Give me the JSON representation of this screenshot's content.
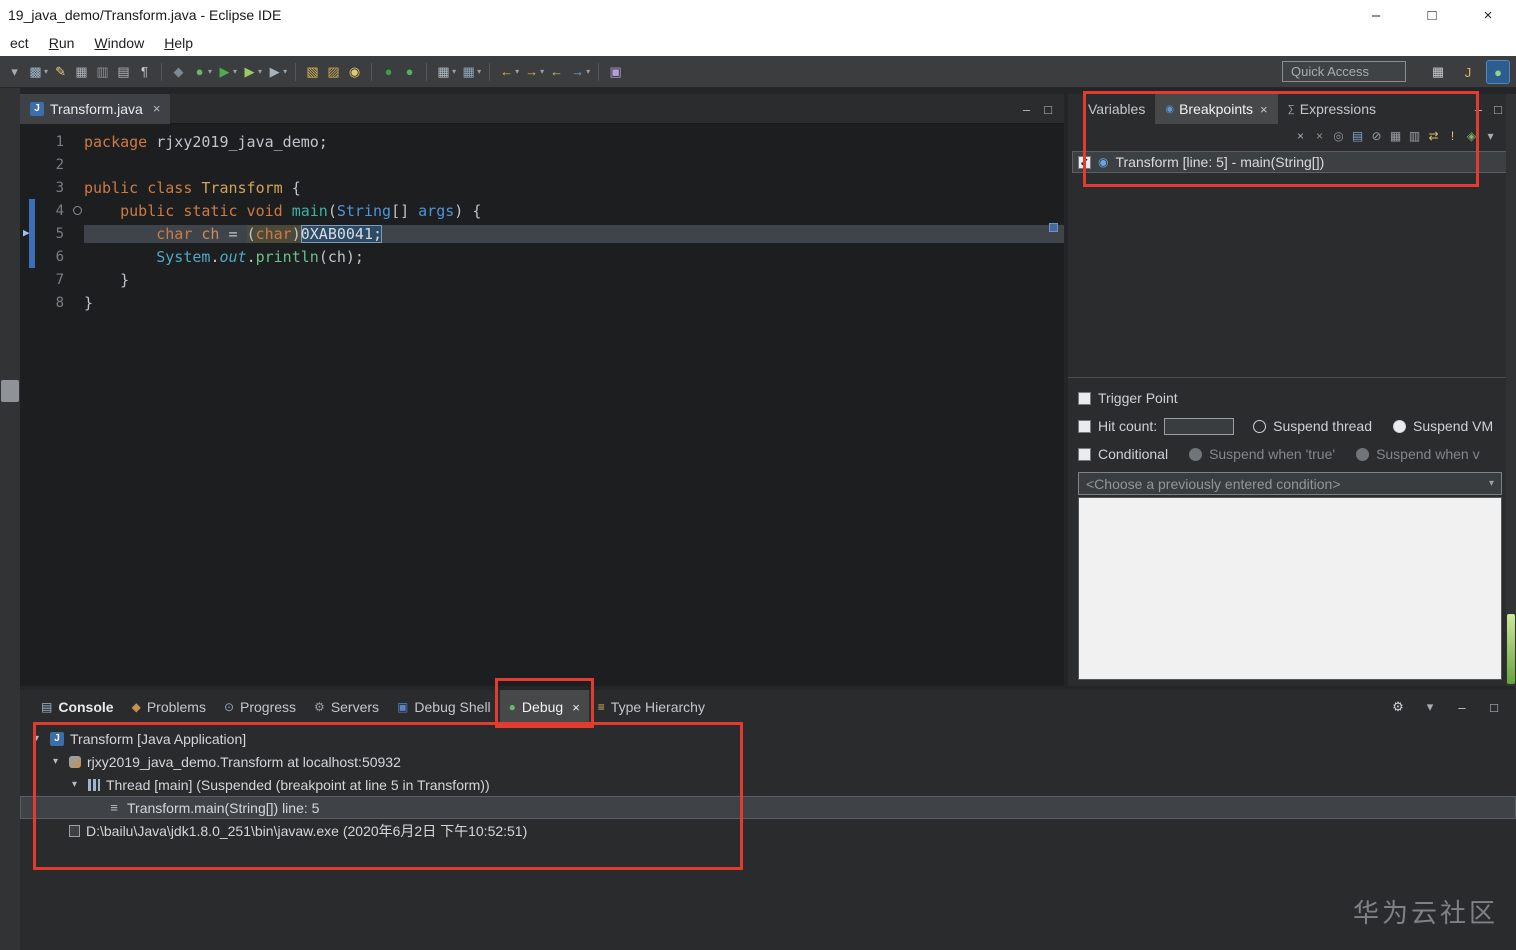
{
  "window": {
    "title": "19_java_demo/Transform.java - Eclipse IDE"
  },
  "icons": {
    "minimize": "–",
    "maximize": "□",
    "close": "×",
    "chevron_down": "▾"
  },
  "colors": {
    "annotation_red": "#e23c30",
    "breakpoint_blue": "#6aa7e0",
    "scroll_thumb_green": "#68a33e"
  },
  "menubar": {
    "items": [
      {
        "label": "ect",
        "accel": false
      },
      {
        "label": "Run",
        "accel": true
      },
      {
        "label": "Window",
        "accel": true
      },
      {
        "label": "Help",
        "accel": true
      }
    ]
  },
  "toolbar": {
    "quick_access": "Quick Access",
    "icons": [
      {
        "name": "overflow-chevron-icon",
        "glyph": "▾",
        "color": "#a7adb3"
      },
      {
        "name": "new-wizard-icon",
        "glyph": "▩",
        "color": "#9fb6c9",
        "dd": true
      },
      {
        "name": "pen-icon",
        "glyph": "✎",
        "color": "#e3cf7f"
      },
      {
        "name": "save-icon",
        "glyph": "▦",
        "color": "#aeb4ba"
      },
      {
        "name": "save-all-icon",
        "glyph": "▥",
        "color": "#8d9399"
      },
      {
        "name": "print-icon",
        "glyph": "▤",
        "color": "#aeb4ba"
      },
      {
        "name": "show-whitespace-icon",
        "glyph": "¶",
        "color": "#c5c9cd"
      },
      {
        "sep": true
      },
      {
        "name": "skip-all-breakpoints-icon",
        "glyph": "◆",
        "color": "#7d8993"
      },
      {
        "name": "debug-icon",
        "glyph": "●",
        "color": "#66b86a",
        "dd": true
      },
      {
        "name": "run-icon",
        "glyph": "▶",
        "color": "#4cae4f",
        "dd": true
      },
      {
        "name": "coverage-icon",
        "glyph": "▶",
        "color": "#9ccc65",
        "dd": true
      },
      {
        "name": "external-tools-icon",
        "glyph": "▶",
        "color": "#a8b2ba",
        "dd": true
      },
      {
        "sep": true
      },
      {
        "name": "open-type-icon",
        "glyph": "▧",
        "color": "#d9b85c"
      },
      {
        "name": "new-package-icon",
        "glyph": "▨",
        "color": "#c9a557"
      },
      {
        "name": "search-icon",
        "glyph": "◉",
        "color": "#e0c96a"
      },
      {
        "sep": true
      },
      {
        "name": "terminal-icon",
        "glyph": "●",
        "color": "#3f9b46"
      },
      {
        "name": "remote-connection-icon",
        "glyph": "●",
        "color": "#58b05c"
      },
      {
        "sep": true
      },
      {
        "name": "table-view-icon",
        "glyph": "▦",
        "color": "#b0bec5",
        "dd": true
      },
      {
        "name": "grid-view-icon",
        "glyph": "▦",
        "color": "#8fa8c0",
        "dd": true
      },
      {
        "sep": true
      },
      {
        "name": "previous-annotation-icon",
        "glyph": "←",
        "color": "#e0b64f",
        "dd": true
      },
      {
        "name": "next-annotation-icon",
        "glyph": "→",
        "color": "#e0b64f",
        "dd": true
      },
      {
        "name": "last-edit-location-icon",
        "glyph": "←",
        "color": "#d9c06a"
      },
      {
        "name": "forward-icon",
        "glyph": "→",
        "color": "#64a7e0",
        "dd": true
      },
      {
        "sep": true
      },
      {
        "name": "screenshot-icon",
        "glyph": "▣",
        "color": "#b39ddb"
      }
    ]
  },
  "editor": {
    "tab": {
      "label": "Transform.java",
      "icon_glyph": "J"
    },
    "lines": [
      {
        "n": "1",
        "seg": [
          [
            "k",
            "package"
          ],
          [
            "p",
            " rjxy2019_java_demo;"
          ]
        ]
      },
      {
        "n": "2",
        "seg": []
      },
      {
        "n": "3",
        "seg": [
          [
            "k",
            "public class "
          ],
          [
            "t",
            "Transform"
          ],
          [
            "p",
            " {"
          ]
        ]
      },
      {
        "n": "4",
        "fold": true,
        "seg": [
          [
            "p",
            "    "
          ],
          [
            "k",
            "public static void "
          ],
          [
            "m",
            "main"
          ],
          [
            "p",
            "("
          ],
          [
            "s",
            "String"
          ],
          [
            "p",
            "[] "
          ],
          [
            "s",
            "args"
          ],
          [
            "p",
            ") {"
          ]
        ]
      },
      {
        "n": "5",
        "current": true,
        "arrow": true,
        "seg": [
          [
            "p",
            "        "
          ],
          [
            "k",
            "char"
          ],
          [
            "p",
            " "
          ],
          [
            "v",
            "ch"
          ],
          [
            "p",
            " = "
          ],
          [
            "khp",
            "("
          ],
          [
            "kh",
            "char"
          ],
          [
            "khp",
            ")"
          ],
          [
            "nb",
            "0XAB0041;"
          ]
        ]
      },
      {
        "n": "6",
        "seg": [
          [
            "p",
            "        "
          ],
          [
            "sys",
            "System"
          ],
          [
            "p",
            "."
          ],
          [
            "fld",
            "out"
          ],
          [
            "p",
            "."
          ],
          [
            "mth",
            "println"
          ],
          [
            "p",
            "(ch);"
          ]
        ]
      },
      {
        "n": "7",
        "seg": [
          [
            "p",
            "    }"
          ]
        ]
      },
      {
        "n": "8",
        "seg": [
          [
            "p",
            "}"
          ]
        ]
      }
    ]
  },
  "right_panel": {
    "tabs": [
      {
        "label": "Variables",
        "active": false
      },
      {
        "label": "Breakpoints",
        "active": true,
        "close": true,
        "icon": "breakpoints-tab-icon",
        "icon_glyph": "◉",
        "icon_color": "#5b9bd5"
      },
      {
        "label": "Expressions",
        "active": false,
        "icon": "expressions-tab-icon",
        "icon_glyph": "∑",
        "icon_color": "#8fa3b8"
      }
    ],
    "toolbar_icons": [
      {
        "name": "remove-breakpoint-icon",
        "glyph": "×",
        "color": "#a7adb3"
      },
      {
        "name": "remove-all-breakpoints-icon",
        "glyph": "×",
        "color": "#8f959b"
      },
      {
        "name": "show-supported-breakpoints-icon",
        "glyph": "◎",
        "color": "#8f959b"
      },
      {
        "name": "go-to-file-icon",
        "glyph": "▤",
        "color": "#7fa3c9"
      },
      {
        "name": "skip-all-breakpoints-icon",
        "glyph": "⊘",
        "color": "#9aa0a6"
      },
      {
        "name": "expand-all-icon",
        "glyph": "▦",
        "color": "#9aa0a6"
      },
      {
        "name": "collapse-all-icon",
        "glyph": "▥",
        "color": "#9aa0a6"
      },
      {
        "name": "link-with-debug-icon",
        "glyph": "⇄",
        "color": "#d9c06a"
      },
      {
        "name": "breakpoint-properties-icon",
        "glyph": "!",
        "color": "#e6c35c"
      },
      {
        "name": "add-breakpoint-icon",
        "glyph": "◈",
        "color": "#7fb069"
      },
      {
        "name": "view-menu-icon",
        "glyph": "▾",
        "color": "#a7adb3"
      }
    ],
    "breakpoint": {
      "checked": true,
      "label": "Transform [line: 5] - main(String[])"
    },
    "detail": {
      "trigger_point": "Trigger Point",
      "hit_count": "Hit count:",
      "suspend_thread": "Suspend thread",
      "suspend_vm": "Suspend VM",
      "conditional": "Conditional",
      "suspend_true": "Suspend when 'true'",
      "suspend_value": "Suspend when v",
      "condition_placeholder": "<Choose a previously entered condition>"
    }
  },
  "bottom_panel": {
    "tabs": [
      {
        "label": "Console",
        "icon": "console-icon",
        "glyph": "▤",
        "color": "#9fb6c9",
        "bold": true
      },
      {
        "label": "Problems",
        "icon": "problems-icon",
        "glyph": "◆",
        "color": "#c98f4e"
      },
      {
        "label": "Progress",
        "icon": "progress-icon",
        "glyph": "⊙",
        "color": "#8fa3b8"
      },
      {
        "label": "Servers",
        "icon": "servers-icon",
        "glyph": "⚙",
        "color": "#9aa0a6"
      },
      {
        "label": "Debug Shell",
        "icon": "debug-shell-icon",
        "glyph": "▣",
        "color": "#5b82c7"
      },
      {
        "label": "Debug",
        "icon": "debug-icon",
        "glyph": "●",
        "color": "#66b86a",
        "active": true,
        "close": true
      },
      {
        "label": "Type Hierarchy",
        "icon": "type-hierarchy-icon",
        "glyph": "≡",
        "color": "#d9b85c"
      }
    ],
    "actions": [
      {
        "name": "debug-toolbar-icon",
        "glyph": "⚙",
        "color": "#d0d4d8"
      },
      {
        "name": "view-menu-icon",
        "glyph": "▾",
        "color": "#a7adb3"
      },
      {
        "name": "minimize-view-icon",
        "glyph": "–",
        "color": "#c5c9cd"
      },
      {
        "name": "maximize-view-icon",
        "glyph": "□",
        "color": "#c5c9cd"
      }
    ],
    "tree": [
      {
        "indent": 0,
        "expander": true,
        "icon": "java-app-icon",
        "label": "Transform [Java Application]"
      },
      {
        "indent": 1,
        "expander": true,
        "icon": "debug-target-icon",
        "label": "rjxy2019_java_demo.Transform at localhost:50932"
      },
      {
        "indent": 2,
        "expander": true,
        "icon": "thread-icon",
        "label": "Thread [main] (Suspended (breakpoint at line 5 in Transform))"
      },
      {
        "indent": 3,
        "expander": false,
        "icon": "stack-frame-icon",
        "label": "Transform.main(String[]) line: 5",
        "selected": true
      },
      {
        "indent": 1,
        "expander": false,
        "icon": "process-icon",
        "label": "D:\\bailu\\Java\\jdk1.8.0_251\\bin\\javaw.exe (2020年6月2日 下午10:52:51)"
      }
    ]
  },
  "watermark": "华为云社区"
}
